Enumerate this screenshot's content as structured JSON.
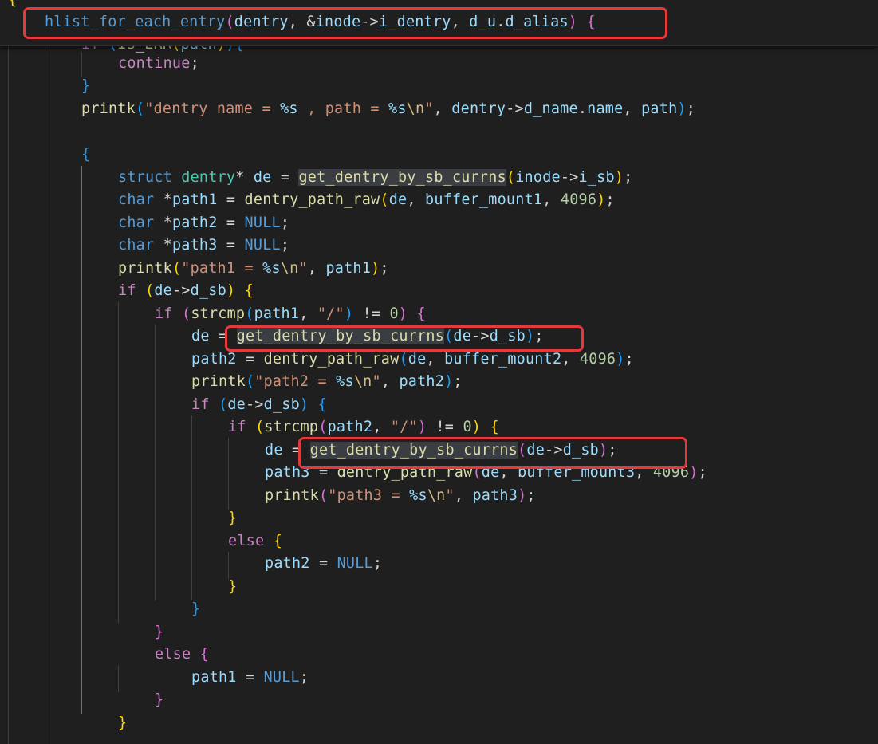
{
  "editor": {
    "colors": {
      "background": "#1f1f1f",
      "highlight_box": "#e5393b"
    },
    "top_fragment": "{",
    "sticky_line": {
      "macro": "hlist_for_each_entry",
      "args_a": "dentry",
      "args_b": "&",
      "args_c": "inode",
      "args_d": "->",
      "args_e": "i_dentry",
      "args_f": "d_u",
      "args_g": ".",
      "args_h": "d_alias"
    },
    "lines": {
      "l1_kw": "if",
      "l1_fn": "IS_ERR",
      "l1_var": "path",
      "l2_kw": "continue",
      "l4_fn": "printk",
      "l4_str1": "\"dentry name = ",
      "l4_fmt1": "%s",
      "l4_str2": " , path = ",
      "l4_fmt2": "%s",
      "l4_esc": "\\n",
      "l4_str3": "\"",
      "l4_var1": "dentry",
      "l4_var2": "d_name",
      "l4_var3": "name",
      "l4_var4": "path",
      "l7_kw": "struct",
      "l7_typ": "dentry",
      "l7_var": "de",
      "l7_fn": "get_dentry_by_sb_currns",
      "l7_arg1": "inode",
      "l7_arg2": "i_sb",
      "l8_kw": "char",
      "l8_var": "path1",
      "l8_fn": "dentry_path_raw",
      "l8_arg1": "de",
      "l8_arg2": "buffer_mount1",
      "l8_num": "4096",
      "l9_kw": "char",
      "l9_var": "path2",
      "l9_null": "NULL",
      "l10_kw": "char",
      "l10_var": "path3",
      "l10_null": "NULL",
      "l11_fn": "printk",
      "l11_str1": "\"path1 = ",
      "l11_fmt": "%s",
      "l11_esc": "\\n",
      "l11_str2": "\"",
      "l11_var": "path1",
      "l12_kw": "if",
      "l12_var1": "de",
      "l12_var2": "d_sb",
      "l13_kw": "if",
      "l13_fn": "strcmp",
      "l13_var": "path1",
      "l13_str": "\"/\"",
      "l13_num": "0",
      "l14_var": "de",
      "l14_fn": "get_dentry_by_sb_currns",
      "l14_arg1": "de",
      "l14_arg2": "d_sb",
      "l15_var": "path2",
      "l15_fn": "dentry_path_raw",
      "l15_arg1": "de",
      "l15_arg2": "buffer_mount2",
      "l15_num": "4096",
      "l16_fn": "printk",
      "l16_str1": "\"path2 = ",
      "l16_fmt": "%s",
      "l16_esc": "\\n",
      "l16_str2": "\"",
      "l16_var": "path2",
      "l17_kw": "if",
      "l17_var1": "de",
      "l17_var2": "d_sb",
      "l18_kw": "if",
      "l18_fn": "strcmp",
      "l18_var": "path2",
      "l18_str": "\"/\"",
      "l18_num": "0",
      "l19_var": "de",
      "l19_fn": "get_dentry_by_sb_currns",
      "l19_arg1": "de",
      "l19_arg2": "d_sb",
      "l20_var": "path3",
      "l20_fn": "dentry_path_raw",
      "l20_arg1": "de",
      "l20_arg2": "buffer_mount3",
      "l20_num": "4096",
      "l21_fn": "printk",
      "l21_str1": "\"path3 = ",
      "l21_fmt": "%s",
      "l21_esc": "\\n",
      "l21_str2": "\"",
      "l21_var": "path3",
      "l23_kw": "else",
      "l24_var": "path2",
      "l24_null": "NULL",
      "l28_kw": "else",
      "l29_var": "path1",
      "l29_null": "NULL"
    }
  }
}
